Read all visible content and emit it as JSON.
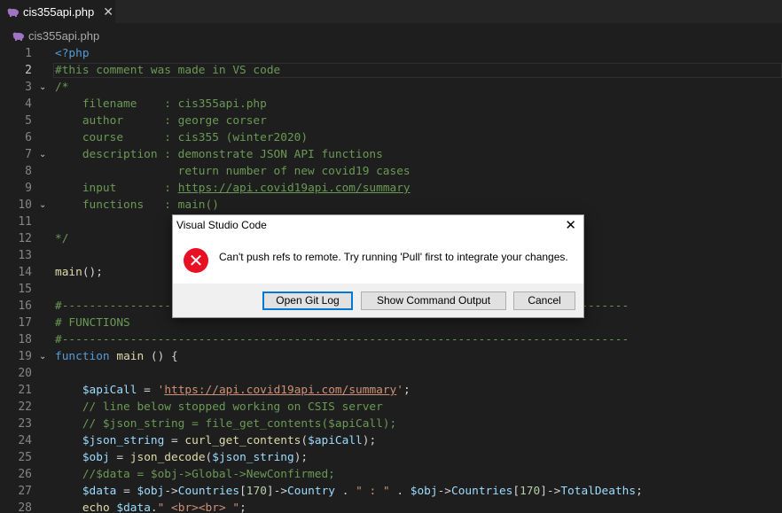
{
  "tab": {
    "label": "cis355api.php",
    "close_glyph": "✕"
  },
  "breadcrumb": {
    "file": "cis355api.php"
  },
  "editor": {
    "lines": [
      {
        "n": "1",
        "fold": false,
        "segs": [
          [
            "kw",
            "<?php"
          ]
        ]
      },
      {
        "n": "2",
        "fold": false,
        "active": true,
        "segs": [
          [
            "cm",
            "#this comment was made in VS code"
          ]
        ]
      },
      {
        "n": "3",
        "fold": true,
        "segs": [
          [
            "cm",
            "/*"
          ]
        ]
      },
      {
        "n": "4",
        "fold": false,
        "segs": [
          [
            "cm",
            "    filename    : cis355api.php"
          ]
        ]
      },
      {
        "n": "5",
        "fold": false,
        "segs": [
          [
            "cm",
            "    author      : george corser"
          ]
        ]
      },
      {
        "n": "6",
        "fold": false,
        "segs": [
          [
            "cm",
            "    course      : cis355 (winter2020)"
          ]
        ]
      },
      {
        "n": "7",
        "fold": true,
        "segs": [
          [
            "cm",
            "    description : demonstrate JSON API functions"
          ]
        ]
      },
      {
        "n": "8",
        "fold": false,
        "segs": [
          [
            "cm",
            "                  return number of new covid19 cases"
          ]
        ]
      },
      {
        "n": "9",
        "fold": false,
        "segs": [
          [
            "cm",
            "    input       : "
          ],
          [
            "cm-u",
            "https://api.covid19api.com/summary"
          ]
        ]
      },
      {
        "n": "10",
        "fold": true,
        "segs": [
          [
            "cm",
            "    functions   : main()"
          ]
        ]
      },
      {
        "n": "11",
        "fold": false,
        "segs": [
          [
            "cm",
            ""
          ]
        ]
      },
      {
        "n": "12",
        "fold": false,
        "segs": [
          [
            "cm",
            "*/"
          ]
        ]
      },
      {
        "n": "13",
        "fold": false,
        "segs": []
      },
      {
        "n": "14",
        "fold": false,
        "segs": [
          [
            "fn",
            "main"
          ],
          [
            "pl",
            "();"
          ]
        ]
      },
      {
        "n": "15",
        "fold": false,
        "segs": []
      },
      {
        "n": "16",
        "fold": false,
        "segs": [
          [
            "cm",
            "#-----------------------------------------------------------------------------------"
          ]
        ]
      },
      {
        "n": "17",
        "fold": false,
        "segs": [
          [
            "cm",
            "# FUNCTIONS"
          ]
        ]
      },
      {
        "n": "18",
        "fold": false,
        "segs": [
          [
            "cm",
            "#-----------------------------------------------------------------------------------"
          ]
        ]
      },
      {
        "n": "19",
        "fold": true,
        "segs": [
          [
            "kw",
            "function"
          ],
          [
            "pl",
            " "
          ],
          [
            "fn",
            "main"
          ],
          [
            "pl",
            " () {"
          ]
        ]
      },
      {
        "n": "20",
        "fold": false,
        "segs": []
      },
      {
        "n": "21",
        "fold": false,
        "segs": [
          [
            "pl",
            "    "
          ],
          [
            "vr",
            "$apiCall"
          ],
          [
            "pl",
            " = "
          ],
          [
            "st",
            "'"
          ],
          [
            "st-u",
            "https://api.covid19api.com/summary"
          ],
          [
            "st",
            "'"
          ],
          [
            "pl",
            ";"
          ]
        ]
      },
      {
        "n": "22",
        "fold": false,
        "segs": [
          [
            "cm",
            "    // line below stopped working on CSIS server"
          ]
        ]
      },
      {
        "n": "23",
        "fold": false,
        "segs": [
          [
            "cm",
            "    // $json_string = file_get_contents($apiCall);"
          ]
        ]
      },
      {
        "n": "24",
        "fold": false,
        "segs": [
          [
            "pl",
            "    "
          ],
          [
            "vr",
            "$json_string"
          ],
          [
            "pl",
            " = "
          ],
          [
            "fn",
            "curl_get_contents"
          ],
          [
            "pl",
            "("
          ],
          [
            "vr",
            "$apiCall"
          ],
          [
            "pl",
            ");"
          ]
        ]
      },
      {
        "n": "25",
        "fold": false,
        "segs": [
          [
            "pl",
            "    "
          ],
          [
            "vr",
            "$obj"
          ],
          [
            "pl",
            " = "
          ],
          [
            "fn",
            "json_decode"
          ],
          [
            "pl",
            "("
          ],
          [
            "vr",
            "$json_string"
          ],
          [
            "pl",
            ");"
          ]
        ]
      },
      {
        "n": "26",
        "fold": false,
        "segs": [
          [
            "cm",
            "    //$data = $obj->Global->NewConfirmed;"
          ]
        ]
      },
      {
        "n": "27",
        "fold": false,
        "segs": [
          [
            "pl",
            "    "
          ],
          [
            "vr",
            "$data"
          ],
          [
            "pl",
            " = "
          ],
          [
            "vr",
            "$obj"
          ],
          [
            "pl",
            "->"
          ],
          [
            "vr",
            "Countries"
          ],
          [
            "pl",
            "["
          ],
          [
            "nm",
            "170"
          ],
          [
            "pl",
            "]->"
          ],
          [
            "vr",
            "Country"
          ],
          [
            "pl",
            " . "
          ],
          [
            "st",
            "\" : \""
          ],
          [
            "pl",
            " . "
          ],
          [
            "vr",
            "$obj"
          ],
          [
            "pl",
            "->"
          ],
          [
            "vr",
            "Countries"
          ],
          [
            "pl",
            "["
          ],
          [
            "nm",
            "170"
          ],
          [
            "pl",
            "]->"
          ],
          [
            "vr",
            "TotalDeaths"
          ],
          [
            "pl",
            ";"
          ]
        ]
      },
      {
        "n": "28",
        "fold": false,
        "segs": [
          [
            "pl",
            "    "
          ],
          [
            "fn",
            "echo"
          ],
          [
            "pl",
            " "
          ],
          [
            "vr",
            "$data"
          ],
          [
            "pl",
            "."
          ],
          [
            "st",
            "\" <br><br> \""
          ],
          [
            "pl",
            ";"
          ]
        ]
      }
    ]
  },
  "dialog": {
    "title": "Visual Studio Code",
    "close_glyph": "✕",
    "icon_glyph": "✕",
    "message": "Can't push refs to remote. Try running 'Pull' first to integrate your changes.",
    "buttons": {
      "open_git_log": "Open Git Log",
      "show_command_output": "Show Command Output",
      "cancel": "Cancel"
    }
  },
  "colors": {
    "editor_bg": "#1e1e1e",
    "comment": "#6a9955",
    "keyword": "#569cd6",
    "error": "#e81123"
  }
}
